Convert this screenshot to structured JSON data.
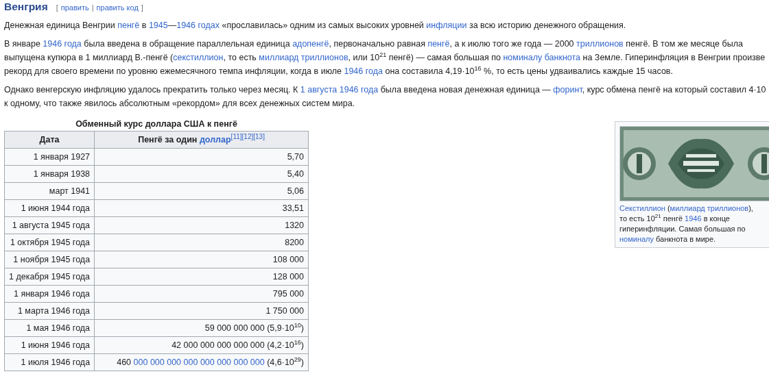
{
  "heading": {
    "title": "Венгрия",
    "open_bracket": "[",
    "separator": "|",
    "close_bracket": "]",
    "edit_links": [
      "править",
      "править код"
    ]
  },
  "paragraphs": [
    {
      "lines": [
        [
          {
            "text": "Денежная единица Венгрии "
          },
          {
            "text": "пенгё",
            "link": true
          },
          {
            "text": " в "
          },
          {
            "text": "1945",
            "link": true
          },
          {
            "text": "—"
          },
          {
            "text": "1946 годах",
            "link": true
          },
          {
            "text": " «прославилась» одним из самых высоких уровней "
          },
          {
            "text": "инфляции",
            "link": true
          },
          {
            "text": " за всю историю денежного обращения."
          }
        ]
      ]
    },
    {
      "lines": [
        [
          {
            "text": "В январе "
          },
          {
            "text": "1946 года",
            "link": true
          },
          {
            "text": " была введена в обращение параллельная единица "
          },
          {
            "text": "адопенгё",
            "link": true
          },
          {
            "text": ", первоначально равная "
          },
          {
            "text": "пенгё",
            "link": true
          },
          {
            "text": ", а к июлю того же года — 2000 "
          },
          {
            "text": "триллионов",
            "link": true
          },
          {
            "text": " пенгё. В том же месяце была"
          }
        ],
        [
          {
            "text": "выпущена купюра в 1 миллиард В.-пенгё ("
          },
          {
            "text": "секстиллион",
            "link": true
          },
          {
            "text": ", то есть "
          },
          {
            "text": "миллиард триллионов",
            "link": true
          },
          {
            "text": ", или 10$^{21}$ пенгё) — самая большая по "
          },
          {
            "text": "номиналу банкнота",
            "link": true
          },
          {
            "text": " на Земле. Гиперинфляция в Венгрии произве"
          }
        ],
        [
          {
            "text": "рекорд для своего времени по уровню ежемесячного темпа инфляции, когда в июле "
          },
          {
            "text": "1946 года",
            "link": true
          },
          {
            "text": " она составила 4,19·10$^{16}$ %, то есть цены удваивались каждые 15 часов."
          }
        ]
      ]
    },
    {
      "lines": [
        [
          {
            "text": "Однако венгерскую инфляцию удалось прекратить только через месяц. К "
          },
          {
            "text": "1 августа 1946 года",
            "link": true
          },
          {
            "text": " была введена новая денежная единица — "
          },
          {
            "text": "форинт",
            "link": true
          },
          {
            "text": ", курс обмена пенгё на который составил 4·10"
          }
        ],
        [
          {
            "text": "к одному, что также явилось абсолютным «рекордом» для всех денежных систем мира."
          }
        ]
      ]
    }
  ],
  "table": {
    "caption": "Обменный курс доллара США к пенгё",
    "columns": [
      {
        "segments": [
          {
            "text": "Дата"
          }
        ]
      },
      {
        "segments": [
          {
            "text": "Пенгё за один "
          },
          {
            "text": "доллар",
            "link": true
          },
          {
            "text": "[11]",
            "link": true,
            "ref": true
          },
          {
            "text": "[12]",
            "link": true,
            "ref": true
          },
          {
            "text": "[13]",
            "link": true,
            "ref": true
          }
        ]
      }
    ],
    "rows": [
      {
        "date": "1 января 1927",
        "value": [
          {
            "text": "5,70"
          }
        ]
      },
      {
        "date": "1 января 1938",
        "value": [
          {
            "text": "5,40"
          }
        ]
      },
      {
        "date": "март 1941",
        "value": [
          {
            "text": "5,06"
          }
        ]
      },
      {
        "date": "1 июня 1944 года",
        "value": [
          {
            "text": "33,51"
          }
        ]
      },
      {
        "date": "1 августа 1945 года",
        "value": [
          {
            "text": "1320"
          }
        ]
      },
      {
        "date": "1 октября 1945 года",
        "value": [
          {
            "text": "8200"
          }
        ]
      },
      {
        "date": "1 ноября 1945 года",
        "value": [
          {
            "text": "108 000"
          }
        ]
      },
      {
        "date": "1 декабря 1945 года",
        "value": [
          {
            "text": "128 000"
          }
        ]
      },
      {
        "date": "1 января 1946 года",
        "value": [
          {
            "text": "795 000"
          }
        ]
      },
      {
        "date": "1 марта 1946 года",
        "value": [
          {
            "text": "1 750 000"
          }
        ]
      },
      {
        "date": "1 мая 1946 года",
        "value": [
          {
            "text": "59 000 000 000 (5,9·10$^{10}$)"
          }
        ]
      },
      {
        "date": "1 июня 1946 года",
        "value": [
          {
            "text": "42 000 000 000 000 000 (4,2·10$^{16}$)"
          }
        ]
      },
      {
        "date": "1 июля 1946 года",
        "value": [
          {
            "text": "460 "
          },
          {
            "text": "000 000 000 000 000 000 000 000",
            "link": true
          },
          {
            "text": " (4,6·10$^{29}$)"
          }
        ]
      }
    ]
  },
  "figure": {
    "caption": [
      {
        "text": "Секстиллион",
        "link": true
      },
      {
        "text": " ("
      },
      {
        "text": "миллиард триллионов",
        "link": true
      },
      {
        "text": "), то есть 10$^{21}$ пенгё "
      },
      {
        "text": "1946",
        "link": true
      },
      {
        "text": " в конце гиперинфляции. Самая большая по "
      },
      {
        "text": "номиналу",
        "link": true
      },
      {
        "text": " банкнота в мире."
      }
    ]
  }
}
